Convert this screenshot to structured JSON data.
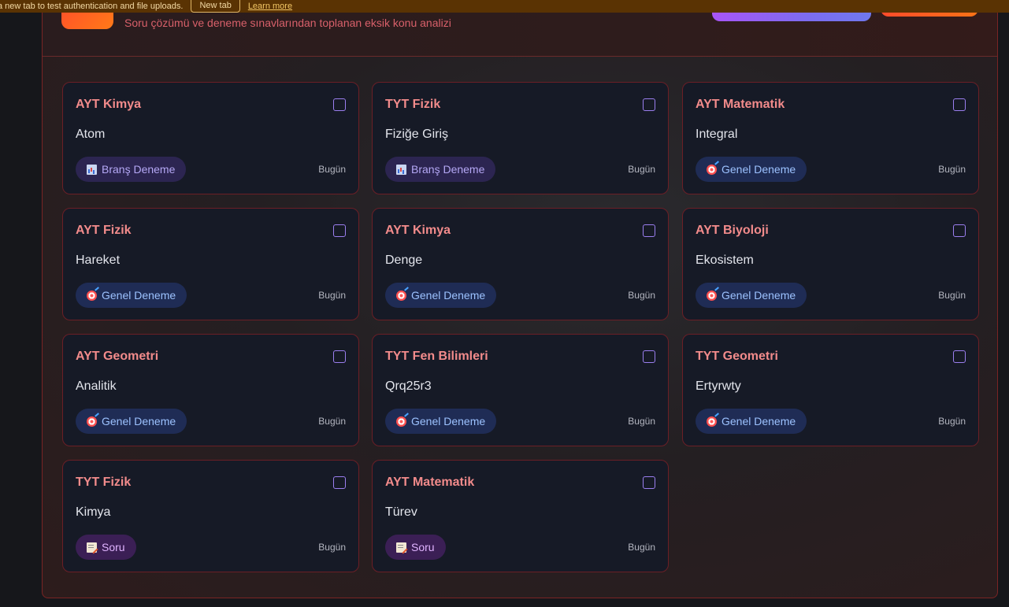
{
  "banner": {
    "text": "a new tab to test authentication and file uploads.",
    "button_label": "New tab",
    "link_label": "Learn more"
  },
  "header": {
    "subtitle": "Soru çözümü ve deneme sınavlarından toplanan eksik konu analizi"
  },
  "cards": [
    {
      "subject": "AYT Kimya",
      "topic": "Atom",
      "badge": "Branş Deneme",
      "badge_type": "brans",
      "badge_icon": "bar-chart-icon",
      "date": "Bugün",
      "checked": false
    },
    {
      "subject": "TYT Fizik",
      "topic": "Fiziğe Giriş",
      "badge": "Branş Deneme",
      "badge_type": "brans",
      "badge_icon": "bar-chart-icon",
      "date": "Bugün",
      "checked": false
    },
    {
      "subject": "AYT Matematik",
      "topic": "Integral",
      "badge": "Genel Deneme",
      "badge_type": "genel",
      "badge_icon": "target-icon",
      "date": "Bugün",
      "checked": false
    },
    {
      "subject": "AYT Fizik",
      "topic": "Hareket",
      "badge": "Genel Deneme",
      "badge_type": "genel",
      "badge_icon": "target-icon",
      "date": "Bugün",
      "checked": false
    },
    {
      "subject": "AYT Kimya",
      "topic": "Denge",
      "badge": "Genel Deneme",
      "badge_type": "genel",
      "badge_icon": "target-icon",
      "date": "Bugün",
      "checked": false
    },
    {
      "subject": "AYT Biyoloji",
      "topic": "Ekosistem",
      "badge": "Genel Deneme",
      "badge_type": "genel",
      "badge_icon": "target-icon",
      "date": "Bugün",
      "checked": false
    },
    {
      "subject": "AYT Geometri",
      "topic": "Analitik",
      "badge": "Genel Deneme",
      "badge_type": "genel",
      "badge_icon": "target-icon",
      "date": "Bugün",
      "checked": false
    },
    {
      "subject": "TYT Fen Bilimleri",
      "topic": "Qrq25r3",
      "badge": "Genel Deneme",
      "badge_type": "genel",
      "badge_icon": "target-icon",
      "date": "Bugün",
      "checked": false
    },
    {
      "subject": "TYT Geometri",
      "topic": "Ertyrwty",
      "badge": "Genel Deneme",
      "badge_type": "genel",
      "badge_icon": "target-icon",
      "date": "Bugün",
      "checked": false
    },
    {
      "subject": "TYT Fizik",
      "topic": "Kimya",
      "badge": "Soru",
      "badge_type": "soru",
      "badge_icon": "memo-icon",
      "date": "Bugün",
      "checked": false
    },
    {
      "subject": "AYT Matematik",
      "topic": "Türev",
      "badge": "Soru",
      "badge_type": "soru",
      "badge_icon": "memo-icon",
      "date": "Bugün",
      "checked": false
    }
  ]
}
